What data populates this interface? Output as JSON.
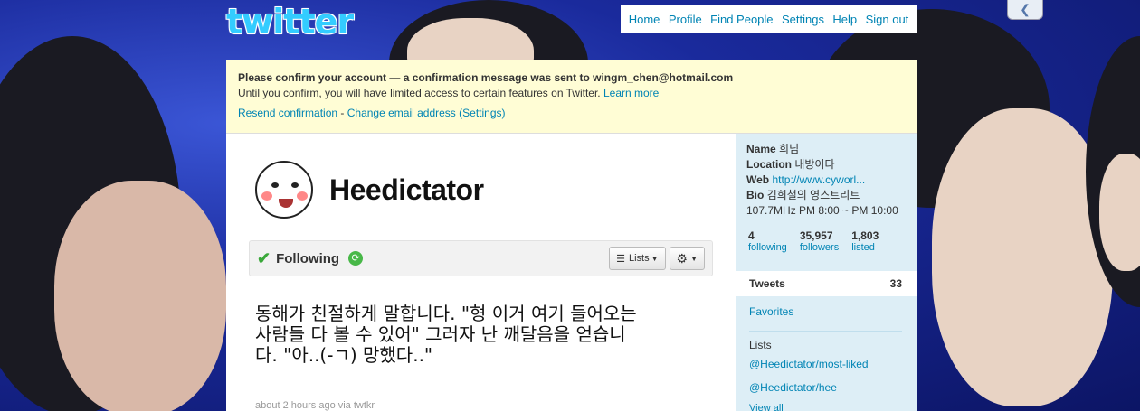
{
  "brand": {
    "logo_text": "twitter"
  },
  "topnav": {
    "items": [
      "Home",
      "Profile",
      "Find People",
      "Settings",
      "Help",
      "Sign out"
    ]
  },
  "notice": {
    "headline": "Please confirm your account — a confirmation message was sent to wingm_chen@hotmail.com",
    "body": "Until you confirm, you will have limited access to certain features on Twitter.",
    "learn_more": "Learn more",
    "resend": "Resend confirmation",
    "separator": " - ",
    "change_email": "Change email address (Settings)"
  },
  "profile": {
    "screen_name": "Heedictator",
    "following_label": "Following",
    "lists_button": "Lists",
    "gear_button": "⚙"
  },
  "tweet": {
    "text": "동해가 친절하게 말합니다. \"형 이거 여기 들어오는 사람들 다 볼 수 있어\" 그러자 난 깨달음을 얻습니다. \"아..(-ㄱ) 망했다..\"",
    "meta": "about 2 hours ago via twtkr"
  },
  "sidebar": {
    "name_label": "Name",
    "name_value": "희님",
    "location_label": "Location",
    "location_value": "내방이다",
    "web_label": "Web",
    "web_value": "http://www.cyworl...",
    "bio_label": "Bio",
    "bio_value": "김희철의 영스트리트 107.7MHz PM 8:00 ~ PM 10:00",
    "stats": [
      {
        "num": "4",
        "label": "following"
      },
      {
        "num": "35,957",
        "label": "followers"
      },
      {
        "num": "1,803",
        "label": "listed"
      }
    ],
    "tweets_label": "Tweets",
    "tweets_count": "33",
    "favorites": "Favorites",
    "lists_heading": "Lists",
    "lists": [
      "@Heedictator/most-liked",
      "@Heedictator/hee"
    ],
    "view_all": "View all"
  },
  "colors": {
    "link": "#0084b4",
    "notice_bg": "#fffdd5",
    "sidebar_bg": "#ddeef6"
  }
}
